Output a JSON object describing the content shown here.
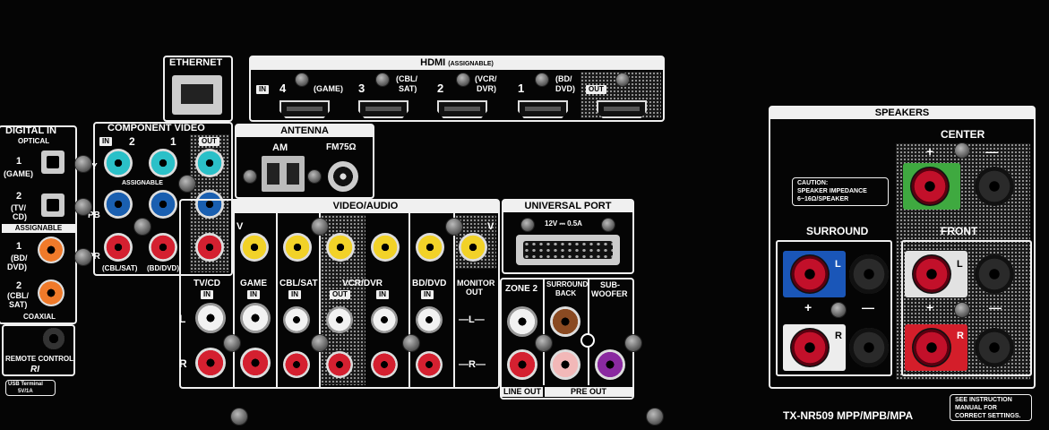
{
  "digital_in": {
    "title": "DIGITAL IN",
    "optical": "OPTICAL",
    "opt1_num": "1",
    "opt1_name": "(GAME)",
    "opt2_num": "2",
    "opt2_name_a": "(TV/",
    "opt2_name_b": "CD)",
    "assignable": "ASSIGNABLE",
    "coax1_num": "1",
    "coax1_name_a": "(BD/",
    "coax1_name_b": "DVD)",
    "coax2_num": "2",
    "coax2_name_a": "(CBL/",
    "coax2_name_b": "SAT)",
    "coaxial": "COAXIAL",
    "remote": "REMOTE CONTROL",
    "ri": "RI",
    "usb_a": "USB Terminal",
    "usb_b": "5V/1A"
  },
  "component": {
    "title": "COMPONENT VIDEO",
    "in": "IN",
    "out": "OUT",
    "n2": "2",
    "n1": "1",
    "assignable": "ASSIGNABLE",
    "y": "Y",
    "pb": "PB",
    "pr": "PR",
    "cbl": "(CBL/SAT)",
    "bd": "(BD/DVD)"
  },
  "ethernet": {
    "title": "ETHERNET"
  },
  "hdmi": {
    "title": "HDMI",
    "title_sub": "(ASSIGNABLE)",
    "in": "IN",
    "p4": "4",
    "p4_name": "(GAME)",
    "p3": "3",
    "p3_name_a": "(CBL/",
    "p3_name_b": "SAT)",
    "p2": "2",
    "p2_name_a": "(VCR/",
    "p2_name_b": "DVR)",
    "p1": "1",
    "p1_name_a": "(BD/",
    "p1_name_b": "DVD)",
    "out": "OUT"
  },
  "antenna": {
    "title": "ANTENNA",
    "am": "AM",
    "fm": "FM75Ω"
  },
  "video_audio": {
    "title": "VIDEO/AUDIO",
    "v": "V",
    "l": "L",
    "r": "R",
    "tvcd": "TV/CD",
    "game": "GAME",
    "cblsat": "CBL/SAT",
    "vcrdvr": "VCR/DVR",
    "bddvd": "BD/DVD",
    "in": "IN",
    "out": "OUT",
    "monitor_a": "MONITOR",
    "monitor_b": "OUT",
    "v2": "V"
  },
  "universal": {
    "title": "UNIVERSAL PORT",
    "power": "12V ⎓ 0.5A"
  },
  "zone2": {
    "zone2": "ZONE 2",
    "sb_a": "SURROUND",
    "sb_b": "BACK",
    "sw_a": "SUB-",
    "sw_b": "WOOFER",
    "l": "—L—",
    "r": "—R—",
    "line_out": "LINE OUT",
    "pre_out": "PRE OUT"
  },
  "speakers": {
    "title": "SPEAKERS",
    "center": "CENTER",
    "caution_a": "CAUTION:",
    "caution_b": "SPEAKER IMPEDANCE",
    "caution_c": "6~16Ω/SPEAKER",
    "surround": "SURROUND",
    "front": "FRONT",
    "plus": "+",
    "minus": "—",
    "l": "L",
    "r": "R"
  },
  "model": "TX-NR509 MPP/MPB/MPA",
  "manual_a": "SEE INSTRUCTION",
  "manual_b": "MANUAL FOR",
  "manual_c": "CORRECT SETTINGS."
}
